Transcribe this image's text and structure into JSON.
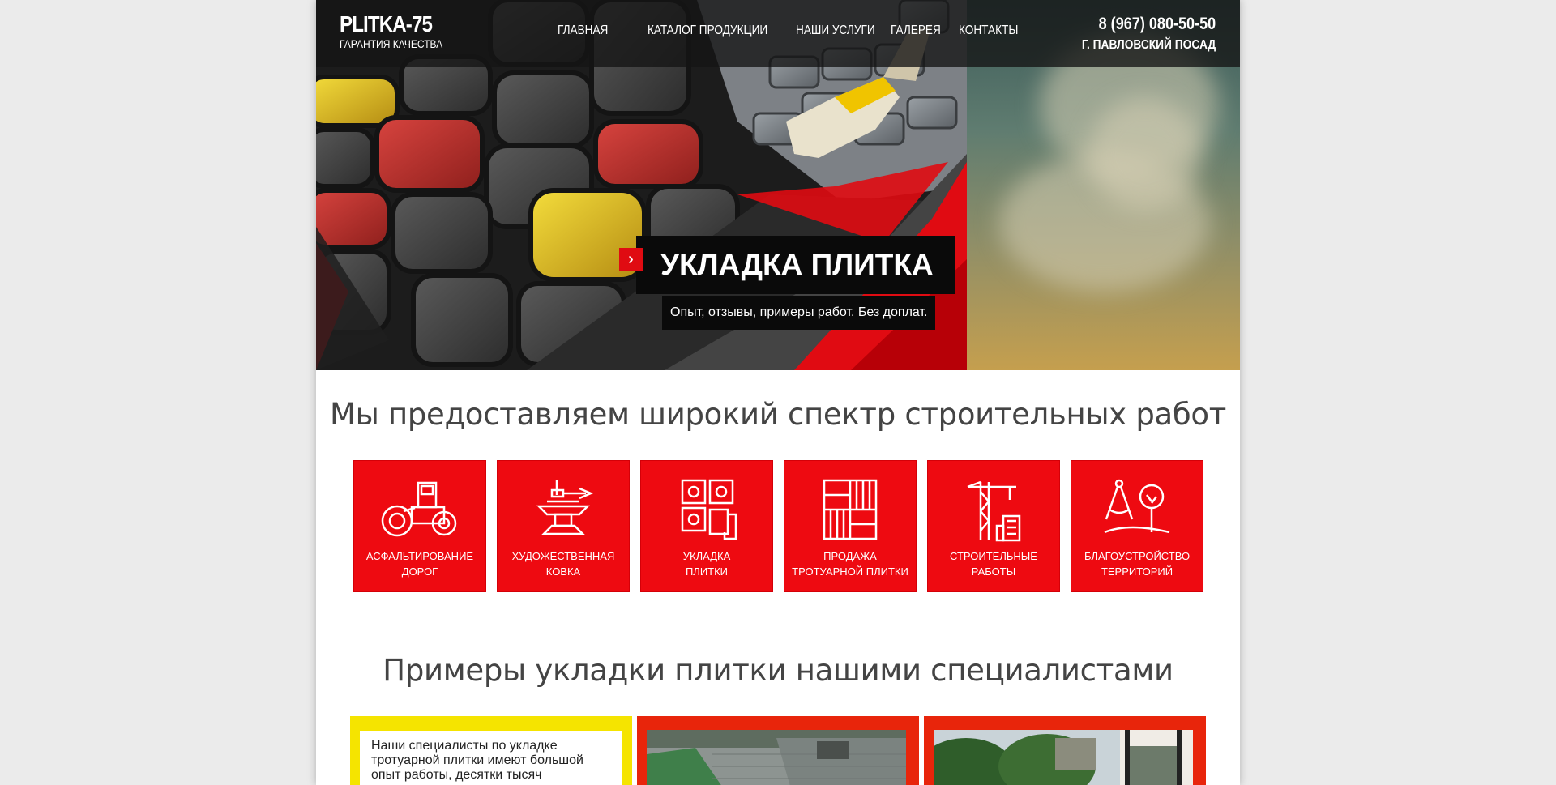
{
  "header": {
    "logo_title": "PLITKA-75",
    "logo_subtitle": "ГАРАНТИЯ КАЧЕСТВА",
    "nav": [
      "ГЛАВНАЯ",
      "КАТАЛОГ ПРОДУКЦИИ",
      "НАШИ УСЛУГИ",
      "ГАЛЕРЕЯ",
      "КОНТАКТЫ"
    ],
    "phone": "8 (967) 080-50-50",
    "city": "Г. ПАВЛОВСКИЙ ПОСАД"
  },
  "hero": {
    "arrow": "›",
    "title": "УКЛАДКА ПЛИТКА",
    "subtitle": "Опыт, отзывы, примеры работ. Без доплат."
  },
  "services_section": {
    "heading": "Мы предоставляем широкий спектр строительных работ",
    "items": [
      {
        "line1": "АСФАЛЬТИРОВАНИЕ",
        "line2": "ДОРОГ",
        "icon": "road-roller-icon"
      },
      {
        "line1": "ХУДОЖЕСТВЕННАЯ",
        "line2": "КОВКА",
        "icon": "anvil-hammer-icon"
      },
      {
        "line1": "УКЛАДКА",
        "line2": "ПЛИТКИ",
        "icon": "tile-laying-icon"
      },
      {
        "line1": "ПРОДАЖА",
        "line2": "ТРОТУАРНОЙ ПЛИТКИ",
        "icon": "paving-pattern-icon"
      },
      {
        "line1": "СТРОИТЕЛЬНЫЕ",
        "line2": "РАБОТЫ",
        "icon": "crane-building-icon"
      },
      {
        "line1": "БЛАГОУСТРОЙСТВО",
        "line2": "ТЕРРИТОРИЙ",
        "icon": "landscape-compass-icon"
      }
    ]
  },
  "examples_section": {
    "heading": "Примеры укладки плитки нашими специалистами",
    "text_lines": [
      "Наши специалисты по укладке",
      "тротуарной плитки имеют большой",
      "опыт работы, десятки тысяч"
    ]
  },
  "colors": {
    "accent_red": "#ee0a11",
    "accent_yellow": "#f5e400",
    "header_bg": "#141414"
  }
}
